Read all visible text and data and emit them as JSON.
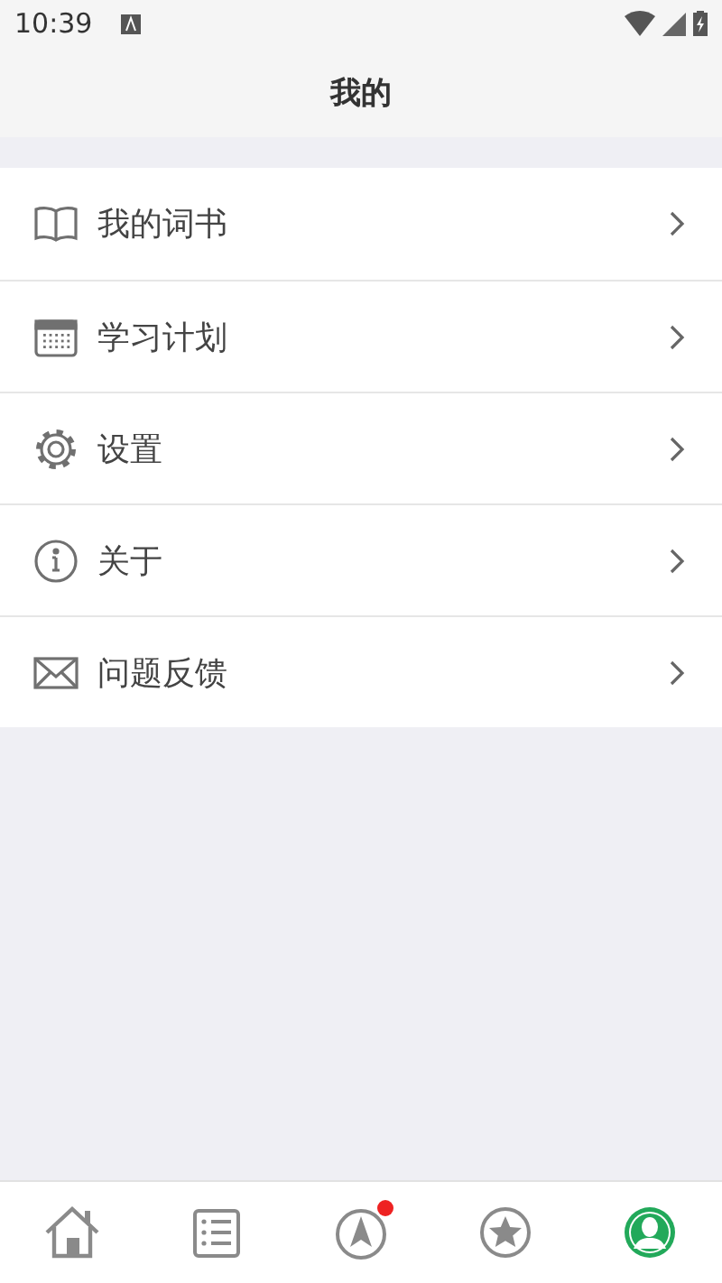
{
  "status_bar": {
    "time": "10:39"
  },
  "header": {
    "title": "我的"
  },
  "menu": [
    {
      "kind": "book",
      "label": "我的词书"
    },
    {
      "kind": "calendar",
      "label": "学习计划"
    },
    {
      "kind": "gear",
      "label": "设置"
    },
    {
      "kind": "info",
      "label": "关于"
    },
    {
      "kind": "mail",
      "label": "问题反馈"
    }
  ],
  "tabs": [
    {
      "kind": "home",
      "selected": false,
      "badge": false
    },
    {
      "kind": "list",
      "selected": false,
      "badge": false
    },
    {
      "kind": "compass",
      "selected": false,
      "badge": true
    },
    {
      "kind": "star",
      "selected": false,
      "badge": false
    },
    {
      "kind": "profile",
      "selected": true,
      "badge": false
    }
  ]
}
